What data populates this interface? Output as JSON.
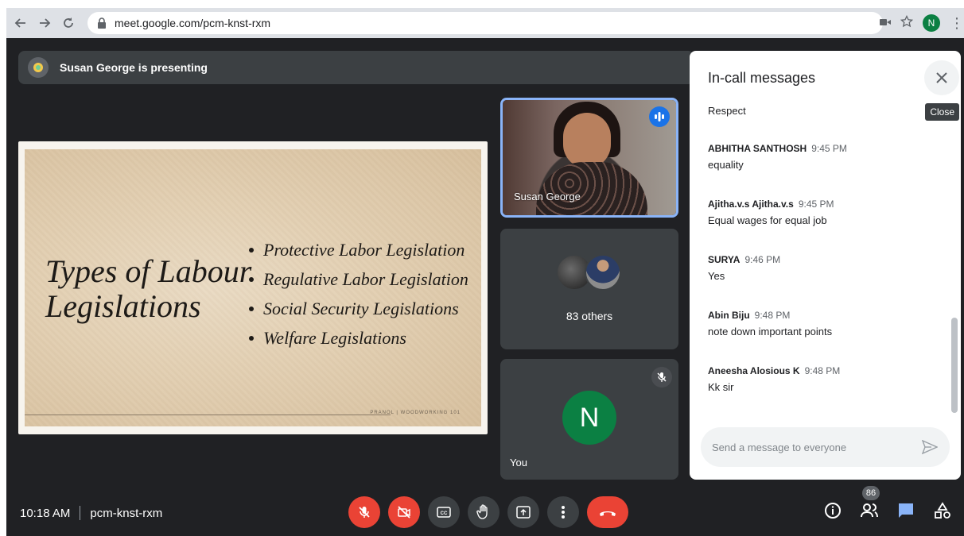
{
  "browser": {
    "url": "meet.google.com/pcm-knst-rxm",
    "profile_initial": "N"
  },
  "meeting": {
    "presenting_text": "Susan George is presenting",
    "time": "10:18 AM",
    "code": "pcm-knst-rxm"
  },
  "slide": {
    "title_line1": "Types of Labour",
    "title_line2": "Legislations",
    "bullets": [
      "Protective Labor Legislation",
      "Regulative Labor Legislation",
      "Social Security Legislations",
      "Welfare Legislations"
    ],
    "footer": "PRANOL | WOODWORKING 101"
  },
  "tiles": {
    "speaker_name": "Susan George",
    "others_label": "83 others",
    "you_label": "You",
    "you_initial": "N"
  },
  "chat": {
    "title": "In-call messages",
    "close_tooltip": "Close",
    "partial_message": "Respect",
    "messages": [
      {
        "sender": "ABHITHA SANTHOSH",
        "time": "9:45 PM",
        "text": "equality"
      },
      {
        "sender": "Ajitha.v.s Ajitha.v.s",
        "time": "9:45 PM",
        "text": "Equal wages for equal job"
      },
      {
        "sender": "SURYA",
        "time": "9:46 PM",
        "text": "Yes"
      },
      {
        "sender": "Abin Biju",
        "time": "9:48 PM",
        "text": "note down important points"
      },
      {
        "sender": "Aneesha Alosious K",
        "time": "9:48 PM",
        "text": "Kk sir"
      }
    ],
    "input_placeholder": "Send a message to everyone"
  },
  "people_count": "86",
  "colors": {
    "meet_bg": "#202124",
    "tile_bg": "#3c4043",
    "accent_blue": "#1a73e8",
    "speaking_border": "#8ab4f8",
    "red": "#ea4335",
    "avatar_green": "#0b8043"
  },
  "icons": {
    "controls": [
      "mic-off-icon",
      "camera-off-icon",
      "captions-icon",
      "raise-hand-icon",
      "present-icon",
      "more-options-icon",
      "hang-up-icon"
    ],
    "right": [
      "info-icon",
      "people-icon",
      "chat-icon",
      "activities-icon"
    ]
  }
}
